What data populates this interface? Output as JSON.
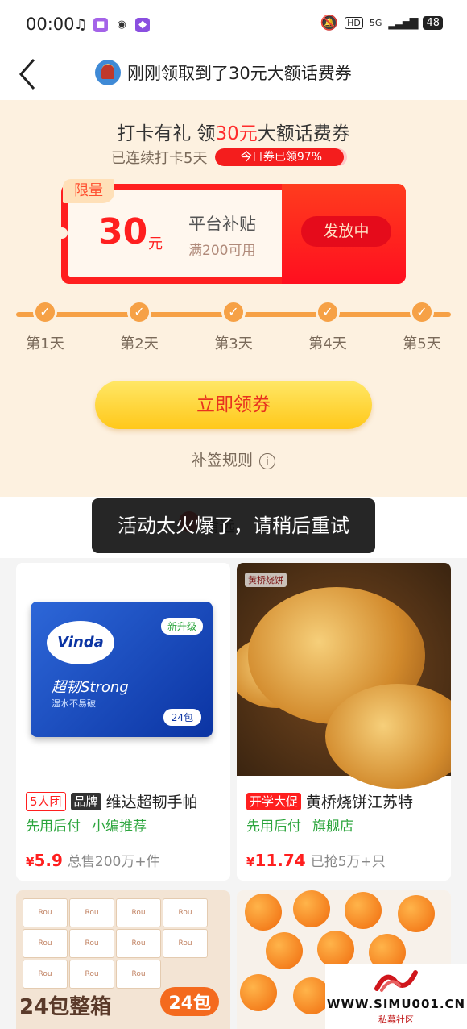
{
  "status_bar": {
    "time": "00:00",
    "hd": "HD",
    "network": "5G",
    "battery": "48"
  },
  "nav": {
    "title": "刚刚领取到了30元大额话费券"
  },
  "checkin": {
    "title_prefix": "打卡有礼 领",
    "title_highlight": "30元",
    "title_suffix": "大额话费券",
    "streak": "已连续打卡5天",
    "today_progress_label": "今日券已领97%",
    "today_progress_percent": 97,
    "coupon": {
      "limit_tag": "限量",
      "amount": "30",
      "unit": "元",
      "name": "平台补贴",
      "condition": "满200可用",
      "status_button": "发放中"
    },
    "days": [
      {
        "label": "第1天",
        "done": true
      },
      {
        "label": "第2天",
        "done": true
      },
      {
        "label": "第3天",
        "done": true
      },
      {
        "label": "第4天",
        "done": true
      },
      {
        "label": "第5天",
        "done": true
      }
    ],
    "claim_button": "立即领券",
    "rules_link": "补签规则"
  },
  "section": {
    "title": "精选"
  },
  "toast": {
    "message": "活动太火爆了，请稍后重试"
  },
  "products": [
    {
      "tags": [
        {
          "text": "5人团",
          "style": "red-outline"
        },
        {
          "text": "品牌",
          "style": "dark"
        }
      ],
      "title": "维达超韧手帕",
      "badges": [
        "先用后付",
        "小编推荐"
      ],
      "price_symbol": "¥",
      "price": "5.9",
      "sold": "总售200万+件",
      "image_text": {
        "logo": "Vinda",
        "badge": "新升级",
        "strong": "超韧Strong",
        "sub": "湿水不易破",
        "count": "24包"
      }
    },
    {
      "tags": [
        {
          "text": "开学大促",
          "style": "red"
        }
      ],
      "title": "黄桥烧饼江苏特",
      "badges": [
        "先用后付",
        "旗舰店"
      ],
      "price_symbol": "¥",
      "price": "11.74",
      "sold": "已抢5万+只",
      "image_text": {
        "brand": "黄桥烧饼"
      }
    }
  ],
  "product_images_row2": {
    "left_banner": "24包整箱",
    "left_badge": "24包",
    "pack_label": "Rou"
  },
  "watermark": {
    "url": "WWW.SIMU001.CN",
    "sub": "私募社区"
  },
  "colors": {
    "accent_red": "#ff1f1f",
    "checkin_bg": "#fdf1e0",
    "progress_orange": "#f6a146",
    "button_yellow": "#ffd23a",
    "green": "#2ca53d"
  }
}
